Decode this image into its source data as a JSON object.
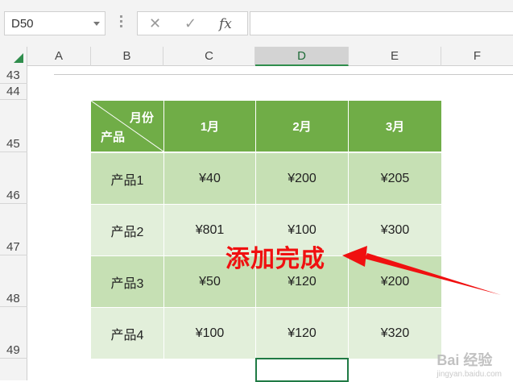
{
  "name_box": {
    "value": "D50"
  },
  "formula_bar": {
    "cancel_icon": "✕",
    "enter_icon": "✓",
    "fx_label": "fx",
    "content": ""
  },
  "columns": [
    "A",
    "B",
    "C",
    "D",
    "E",
    "F"
  ],
  "selected_column": "D",
  "rows": [
    "43",
    "44",
    "45",
    "46",
    "47",
    "48",
    "49"
  ],
  "table": {
    "diag_top": "月份",
    "diag_bottom": "产品",
    "months": [
      "1月",
      "2月",
      "3月"
    ],
    "rows": [
      {
        "product": "产品1",
        "values": [
          "¥40",
          "¥200",
          "¥205"
        ]
      },
      {
        "product": "产品2",
        "values": [
          "¥801",
          "¥100",
          "¥300"
        ]
      },
      {
        "product": "产品3",
        "values": [
          "¥50",
          "¥120",
          "¥200"
        ]
      },
      {
        "product": "产品4",
        "values": [
          "¥100",
          "¥120",
          "¥320"
        ]
      }
    ]
  },
  "annotation": {
    "text": "添加完成",
    "color": "#f01010"
  },
  "colors": {
    "header_green": "#70ad47",
    "band_dark": "#c6e0b4",
    "band_light": "#e2efda"
  },
  "watermark": {
    "brand": "Bai 经验",
    "url": "jingyan.baidu.com"
  }
}
